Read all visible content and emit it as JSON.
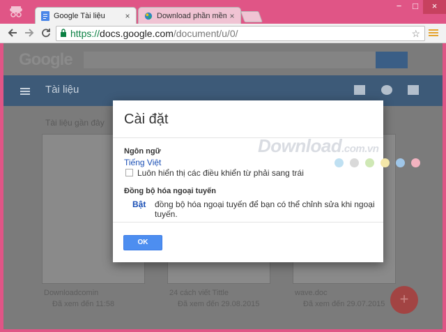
{
  "browser": {
    "tabs": [
      {
        "title": "Google Tài liệu",
        "active": true
      },
      {
        "title": "Download phần mềm miễ",
        "active": false
      }
    ],
    "close_glyph": "×",
    "url": {
      "scheme": "https://",
      "host": "docs.google.com",
      "path": "/document/u/0/"
    },
    "nav": {
      "back": "←",
      "forward": "→",
      "reload": "C"
    },
    "window_controls": {
      "minimize": "−",
      "maximize": "□",
      "close": "×"
    }
  },
  "background_page": {
    "logo": "Google",
    "app_title": "Tài liệu",
    "recent_label": "Tài liệu gần đây",
    "docs": [
      {
        "name": "Downloadcomin",
        "meta": "Đã xem đến 11:58"
      },
      {
        "name": "24 cách viết Tittle",
        "meta": "Đã xem đến 29.08.2015"
      },
      {
        "name": "wave.doc",
        "meta": "Đã xem đến 29.07.2015"
      }
    ],
    "fab_label": "+"
  },
  "dialog": {
    "title": "Cài đặt",
    "language_label": "Ngôn ngữ",
    "language_value": "Tiếng Việt",
    "rtl_checkbox_label": "Luôn hiển thị các điều khiển từ phải sang trái",
    "rtl_checked": false,
    "offline_label": "Đồng bộ hóa ngoại tuyến",
    "offline_state": "Bật",
    "offline_desc": "đồng bộ hóa ngoại tuyến để bạn có thể chỉnh sửa khi ngoại tuyến.",
    "ok_label": "OK"
  },
  "watermark": {
    "text": "Download",
    "suffix": ".com.vn",
    "dots": [
      "#bfe0f2",
      "#d9d9d9",
      "#cfe8b5",
      "#f4e7a9",
      "#9fc6e8",
      "#f3b3c0"
    ]
  }
}
